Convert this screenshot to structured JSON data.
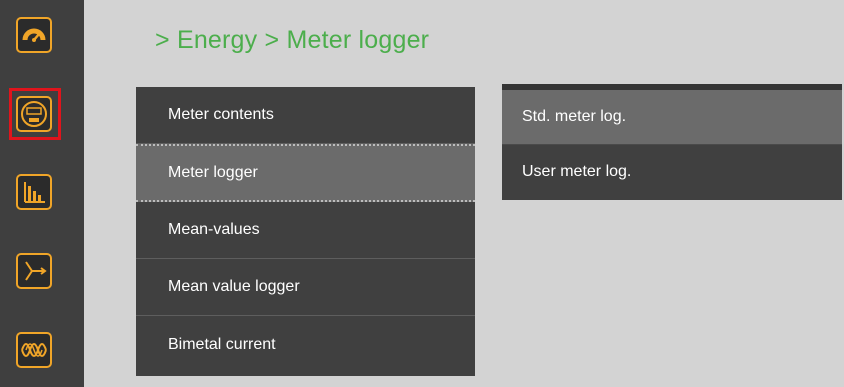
{
  "breadcrumb": "> Energy > Meter logger",
  "sidebar": {
    "icons": [
      "gauge-icon",
      "energy-meter-icon",
      "bar-chart-icon",
      "three-phase-vector-icon",
      "waveform-icon"
    ],
    "selected_index": 1,
    "accent_color": "#f0a528",
    "selected_color": "#e0141c"
  },
  "menu": {
    "items": [
      {
        "label": "Meter contents"
      },
      {
        "label": "Meter logger",
        "active": true
      },
      {
        "label": "Mean-values"
      },
      {
        "label": "Mean value logger"
      },
      {
        "label": "Bimetal current"
      }
    ]
  },
  "submenu": {
    "items": [
      {
        "label": "Std. meter log.",
        "active": true
      },
      {
        "label": "User meter log."
      }
    ]
  },
  "colors": {
    "breadcrumb": "#4cae4c",
    "background": "#d3d3d3",
    "menu_bg": "#404040",
    "menu_active_bg": "#6b6b6b"
  }
}
